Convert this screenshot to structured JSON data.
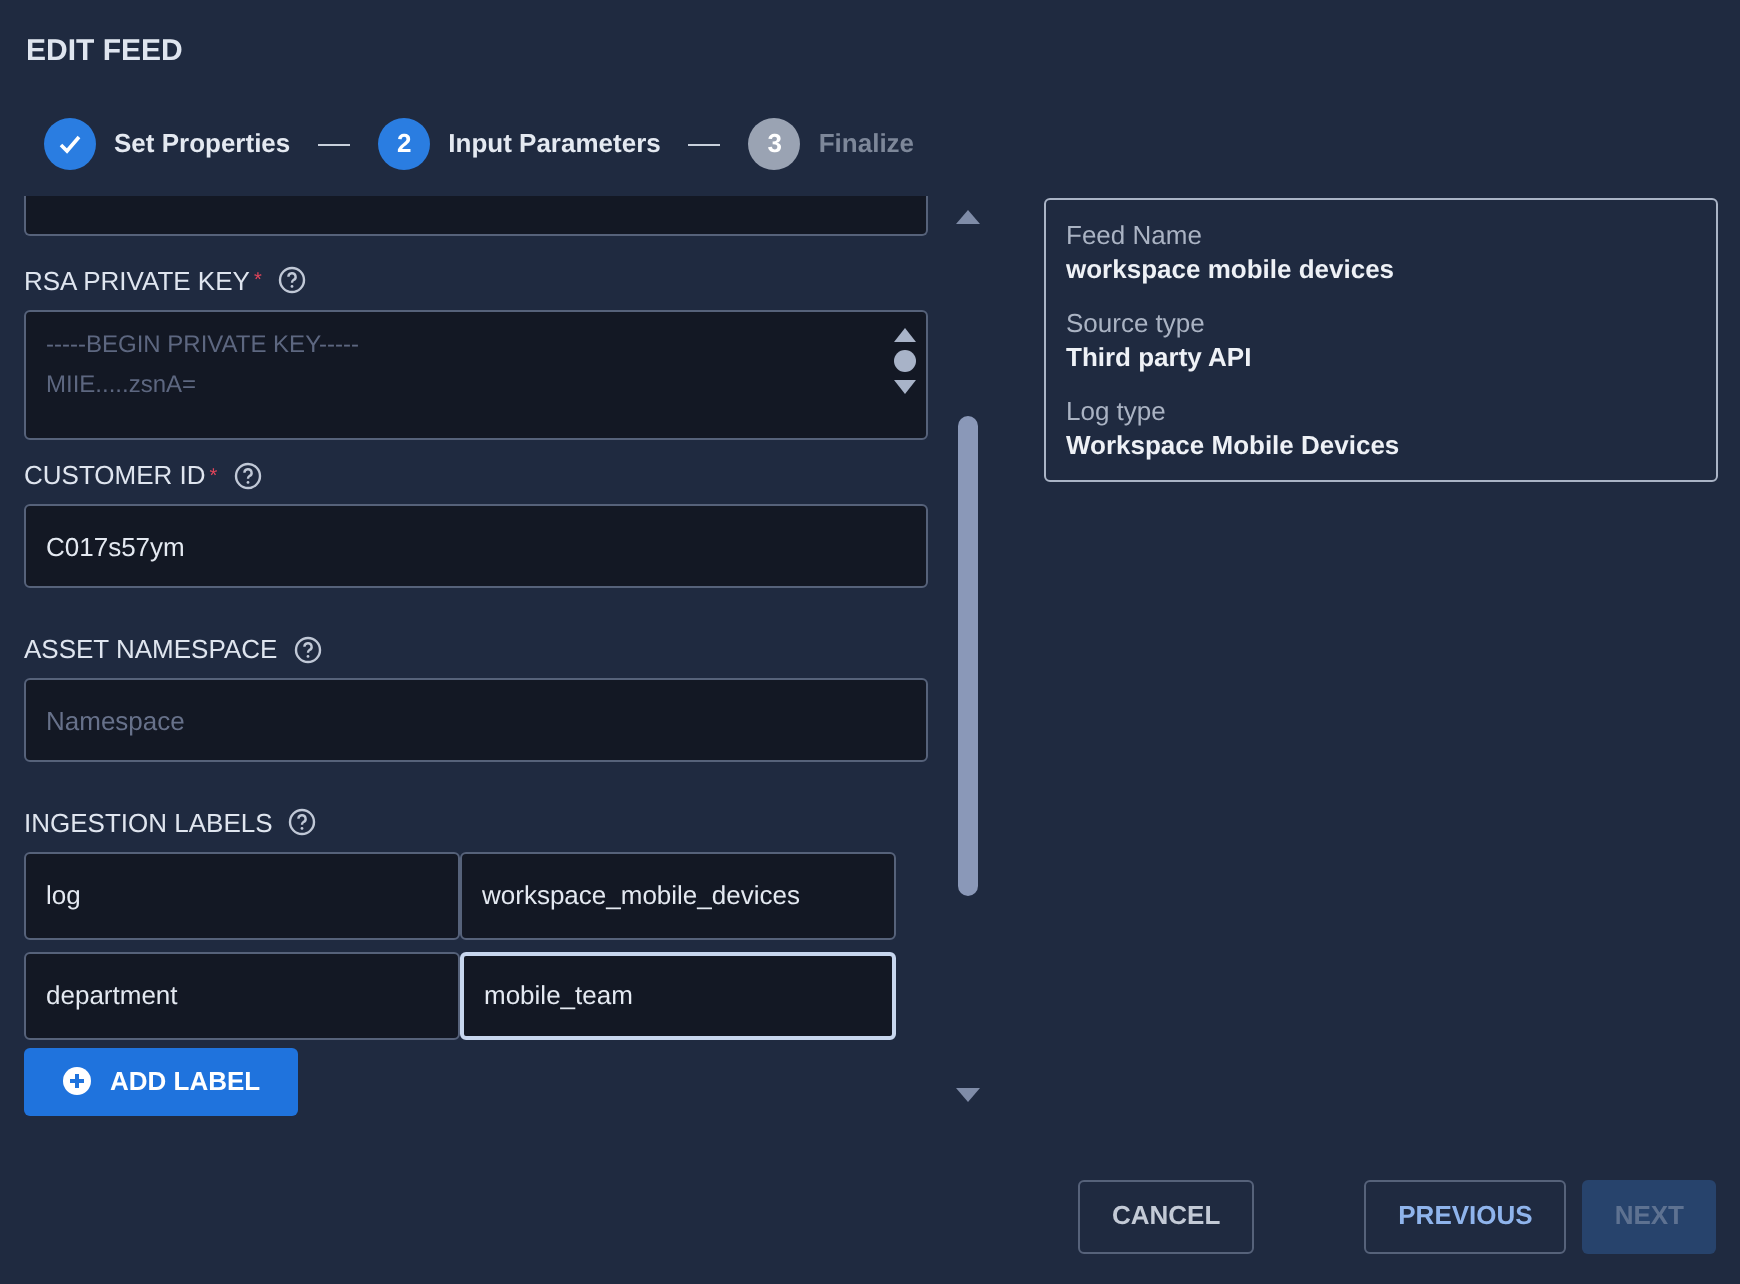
{
  "dialog": {
    "title": "EDIT FEED"
  },
  "steps": [
    {
      "label": "Set Properties",
      "kind": "done"
    },
    {
      "number": "2",
      "label": "Input Parameters",
      "kind": "active"
    },
    {
      "number": "3",
      "label": "Finalize",
      "kind": "pending"
    }
  ],
  "form": {
    "fields": [
      {
        "kind": "textarea",
        "label": "RSA PRIVATE KEY",
        "required_mark": "*",
        "placeholder_lines": [
          "-----BEGIN PRIVATE KEY-----",
          "MIIE.....zsnA="
        ]
      },
      {
        "kind": "text",
        "label": "CUSTOMER ID",
        "required_mark": "*",
        "value": "C017s57ym"
      },
      {
        "kind": "text",
        "label": "ASSET NAMESPACE",
        "placeholder": "Namespace"
      },
      {
        "kind": "labels",
        "label": "INGESTION LABELS",
        "rows": [
          {
            "key": "log",
            "value": "workspace_mobile_devices",
            "focused": false
          },
          {
            "key": "department",
            "value": "mobile_team",
            "focused": true
          }
        ]
      }
    ],
    "add_button": "ADD LABEL"
  },
  "summary": [
    {
      "label": "Feed Name",
      "value": "workspace mobile devices"
    },
    {
      "label": "Source type",
      "value": "Third party API"
    },
    {
      "label": "Log type",
      "value": "Workspace Mobile Devices"
    }
  ],
  "buttons": [
    {
      "label": "CANCEL",
      "kind": "outline",
      "disabled": false
    },
    {
      "label": "PREVIOUS",
      "kind": "primary-outline",
      "disabled": false
    },
    {
      "label": "NEXT",
      "kind": "filled",
      "disabled": true
    }
  ]
}
